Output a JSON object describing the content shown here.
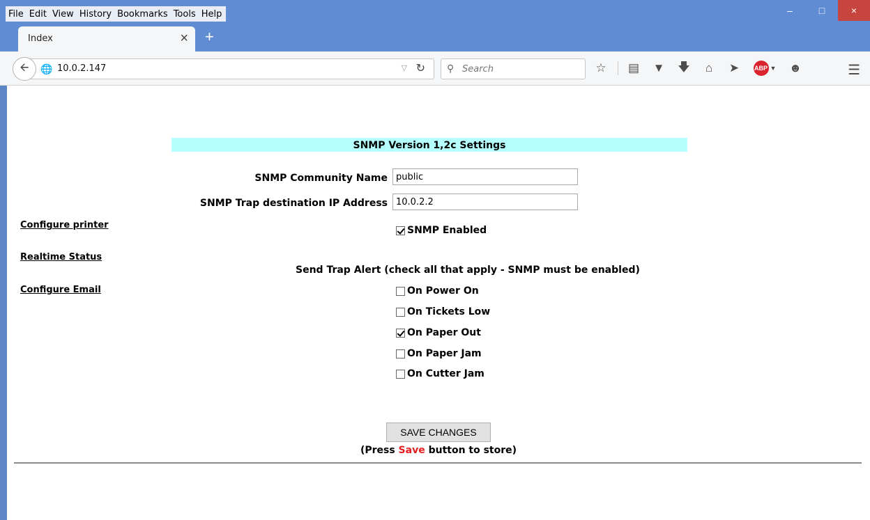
{
  "browser": {
    "menu": [
      "File",
      "Edit",
      "View",
      "History",
      "Bookmarks",
      "Tools",
      "Help"
    ],
    "window_controls": {
      "minimize": "–",
      "maximize": "□",
      "close": "×"
    },
    "tab_title": "Index",
    "tab_close": "×",
    "new_tab": "+",
    "url": "10.0.2.147",
    "search_placeholder": "Search",
    "toolbar_icons": [
      "bookmark-star-icon",
      "reading-list-icon",
      "pocket-icon",
      "download-icon",
      "home-icon",
      "send-icon",
      "adblock-plus-icon",
      "chat-icon",
      "menu-icon"
    ],
    "adblock_label": "ABP"
  },
  "sidebar": {
    "links": [
      "Configure printer",
      "Realtime Status",
      "Configure Email"
    ]
  },
  "form": {
    "heading": "SNMP Version 1,2c Settings",
    "community_label": "SNMP Community Name",
    "community_value": "public",
    "trap_ip_label": "SNMP Trap destination IP Address",
    "trap_ip_value": "10.0.2.2",
    "snmp_enabled_label": "SNMP Enabled",
    "snmp_enabled": true,
    "trap_alert_label": "Send Trap Alert  (check all that apply - SNMP must be enabled)",
    "alerts": [
      {
        "label": "On Power On",
        "checked": false
      },
      {
        "label": "On Tickets Low",
        "checked": false
      },
      {
        "label": "On Paper Out",
        "checked": true
      },
      {
        "label": "On Paper Jam",
        "checked": false
      },
      {
        "label": "On Cutter Jam",
        "checked": false
      }
    ],
    "save_button": "SAVE CHANGES",
    "save_note_prefix": "(Press ",
    "save_note_highlight": "Save",
    "save_note_suffix": " button to store)"
  },
  "colors": {
    "heading_bg": "#b6ffff",
    "save_highlight": "#e51d1d",
    "chrome_blue": "#5f8cd2"
  }
}
